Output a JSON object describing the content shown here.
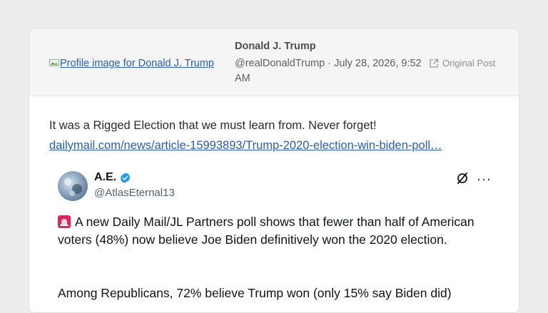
{
  "header": {
    "profile_image_alt": "Profile image for Donald J. Trump",
    "author_name": "Donald J. Trump",
    "author_meta": "@realDonaldTrump · July 28, 2026, 9:52 AM",
    "original_post_label": "Original Post"
  },
  "post": {
    "text": "It was a Rigged Election that we must learn from. Never forget!",
    "link": "dailymail.com/news/article-15993893/Trump-2020-election-win-biden-poll…"
  },
  "embed": {
    "name": "A.E.",
    "handle": "@AtlasEternal13",
    "text_line1": "A new Daily Mail/JL Partners poll shows that fewer than half of American voters (48%) now believe Joe Biden definitively won the 2020 election.",
    "text_line2": "Among Republicans, 72% believe Trump won (only 15% say Biden did)"
  },
  "colors": {
    "link": "#2a5db0",
    "verified_badge": "#1d9bf0",
    "siren": "#e0245e"
  }
}
